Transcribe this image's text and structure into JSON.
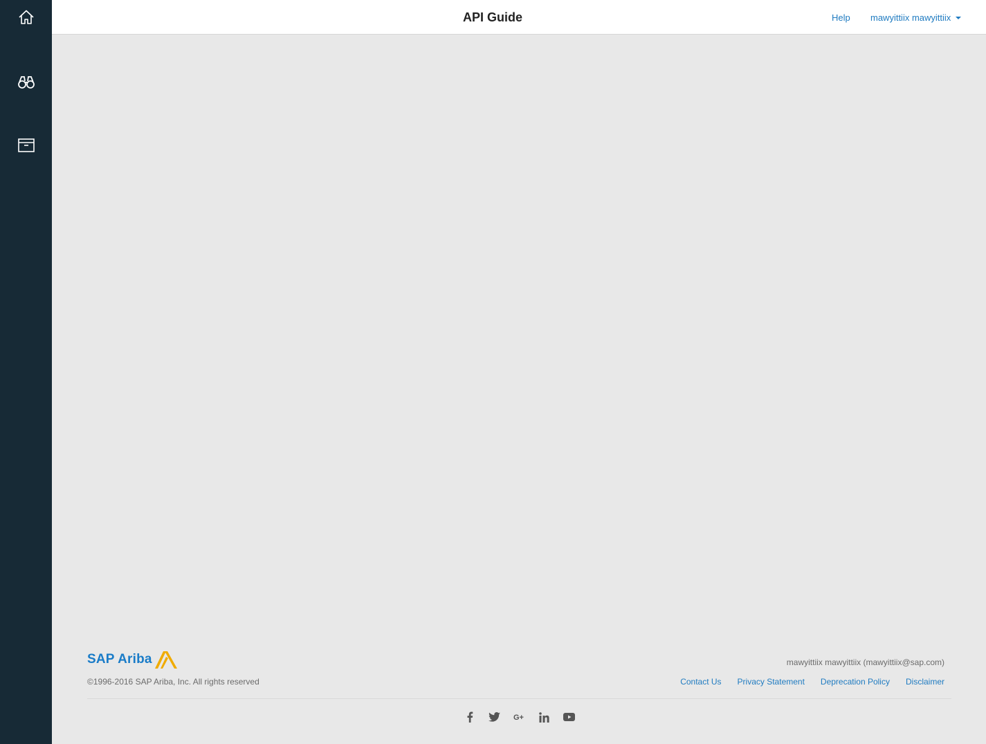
{
  "header": {
    "title": "API Guide",
    "help_label": "Help",
    "user_label": "mawyittiix mawyittiix"
  },
  "sidebar": {
    "items": [
      {
        "icon": "home-icon"
      },
      {
        "icon": "binoculars-icon"
      },
      {
        "icon": "archive-box-icon"
      }
    ]
  },
  "footer": {
    "brand_text": "SAP Ariba",
    "copyright": "©1996-2016 SAP Ariba, Inc. All rights reserved",
    "account": "mawyittiix mawyittiix (mawyittiix@sap.com)",
    "links": [
      "Contact Us",
      "Privacy Statement",
      "Deprecation Policy",
      "Disclaimer"
    ],
    "social": [
      "facebook-icon",
      "twitter-icon",
      "google-plus-icon",
      "linkedin-icon",
      "youtube-icon"
    ]
  },
  "colors": {
    "sidebar_bg": "#172a36",
    "page_bg": "#e8e8e8",
    "link": "#1f7bc1",
    "brand_blue": "#1a7cc8",
    "brand_gold": "#f0ab00"
  }
}
